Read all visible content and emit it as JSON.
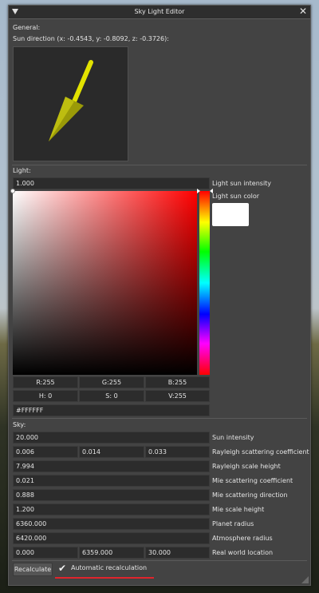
{
  "window": {
    "title": "Sky Light Editor"
  },
  "general": {
    "label": "General:",
    "sun_direction": "Sun direction (x: -0.4543, y: -0.8092, z: -0.3726):"
  },
  "light": {
    "label": "Light:",
    "intensity_value": "1.000",
    "intensity_label": "Light sun intensity",
    "color_label": "Light sun color",
    "color_hex_value": "#FFFFFF",
    "color_hex": "#FFFFFF",
    "r": "R:255",
    "g": "G:255",
    "b": "B:255",
    "h": "H:  0",
    "s": "S:  0",
    "v": "V:255"
  },
  "sky": {
    "label": "Sky:",
    "sun_intensity": {
      "value": "20.000",
      "label": "Sun intensity"
    },
    "rayleigh_coef": {
      "values": [
        "0.006",
        "0.014",
        "0.033"
      ],
      "label": "Rayleigh scattering coefficient"
    },
    "rayleigh_height": {
      "value": "7.994",
      "label": "Rayleigh scale height"
    },
    "mie_coef": {
      "value": "0.021",
      "label": "Mie scattering coefficient"
    },
    "mie_dir": {
      "value": "0.888",
      "label": "Mie scattering direction"
    },
    "mie_height": {
      "value": "1.200",
      "label": "Mie scale height"
    },
    "planet_radius": {
      "value": "6360.000",
      "label": "Planet radius"
    },
    "atmosphere_radius": {
      "value": "6420.000",
      "label": "Atmosphere radius"
    },
    "world_location": {
      "values": [
        "0.000",
        "6359.000",
        "30.000"
      ],
      "label": "Real world location"
    }
  },
  "footer": {
    "recalculate": "Recalculate",
    "auto_recalc_label": "Automatic recalculation",
    "auto_recalc_checked": "✔"
  },
  "icons": {
    "collapse": "triangle-down-icon",
    "close": "close-icon",
    "check": "checkmark-icon",
    "resize": "resize-grip-icon"
  },
  "colors": {
    "window_bg": "#434343",
    "title_bg": "#2e2e2e",
    "field_bg": "#2c2c2c",
    "accent_underline": "#e0242c",
    "arrow": "#d8d800"
  }
}
